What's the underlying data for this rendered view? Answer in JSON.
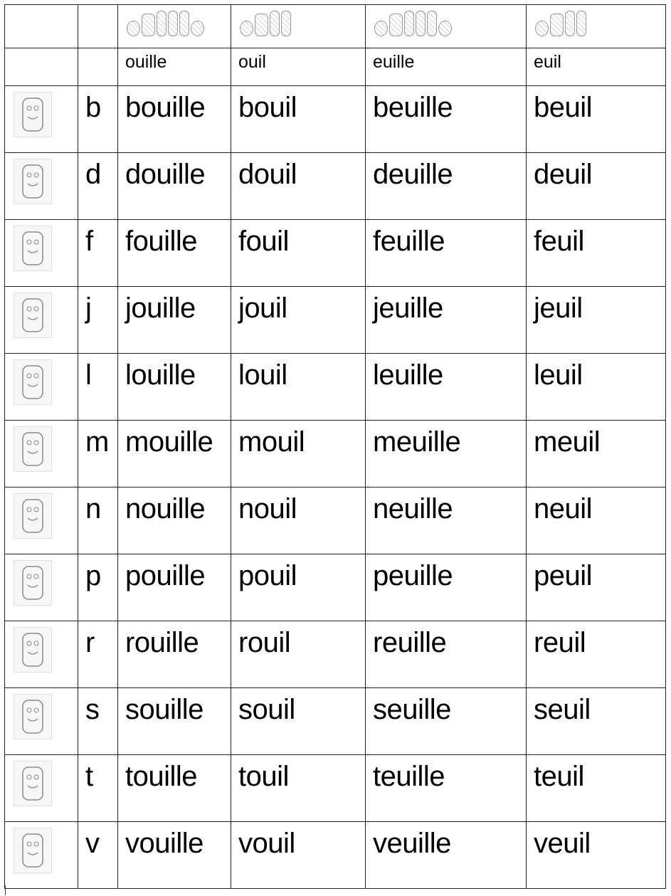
{
  "table": {
    "header_labels": [
      "ouille",
      "ouil",
      "euille",
      "euil"
    ],
    "header_pattern_icons": [
      [
        "o-icon",
        "u-icon",
        "i-icon",
        "l-icon",
        "l-icon",
        "e-icon"
      ],
      [
        "o-icon",
        "u-icon",
        "i-icon",
        "l-icon"
      ],
      [
        "e-icon",
        "u-icon",
        "i-icon",
        "l-icon",
        "l-icon",
        "e-icon"
      ],
      [
        "e-icon",
        "u-icon",
        "i-icon",
        "l-icon"
      ]
    ],
    "rows": [
      {
        "letter": "b",
        "icon": "letter-b-illustration",
        "words": [
          "bouille",
          "bouil",
          "beuille",
          "beuil"
        ]
      },
      {
        "letter": "d",
        "icon": "letter-d-illustration",
        "words": [
          "douille",
          "douil",
          "deuille",
          "deuil"
        ]
      },
      {
        "letter": "f",
        "icon": "letter-f-illustration",
        "words": [
          "fouille",
          "fouil",
          "feuille",
          "feuil"
        ]
      },
      {
        "letter": "j",
        "icon": "letter-j-illustration",
        "words": [
          "jouille",
          "jouil",
          "jeuille",
          "jeuil"
        ]
      },
      {
        "letter": "l",
        "icon": "letter-l-illustration",
        "words": [
          "louille",
          "louil",
          "leuille",
          "leuil"
        ]
      },
      {
        "letter": "m",
        "icon": "letter-m-illustration",
        "words": [
          "mouille",
          "mouil",
          "meuille",
          "meuil"
        ]
      },
      {
        "letter": "n",
        "icon": "letter-n-illustration",
        "words": [
          "nouille",
          "nouil",
          "neuille",
          "neuil"
        ]
      },
      {
        "letter": "p",
        "icon": "letter-p-illustration",
        "words": [
          "pouille",
          "pouil",
          "peuille",
          "peuil"
        ]
      },
      {
        "letter": "r",
        "icon": "letter-r-illustration",
        "words": [
          "rouille",
          "rouil",
          "reuille",
          "reuil"
        ]
      },
      {
        "letter": "s",
        "icon": "letter-s-illustration",
        "words": [
          "souille",
          "souil",
          "seuille",
          "seuil"
        ]
      },
      {
        "letter": "t",
        "icon": "letter-t-illustration",
        "words": [
          "touille",
          "touil",
          "teuille",
          "teuil"
        ]
      },
      {
        "letter": "v",
        "icon": "letter-v-illustration",
        "words": [
          "vouille",
          "vouil",
          "veuille",
          "veuil"
        ]
      }
    ]
  },
  "colors": {
    "border": "#222222",
    "text": "#000000",
    "illustration_stroke": "#8a8a8a"
  }
}
